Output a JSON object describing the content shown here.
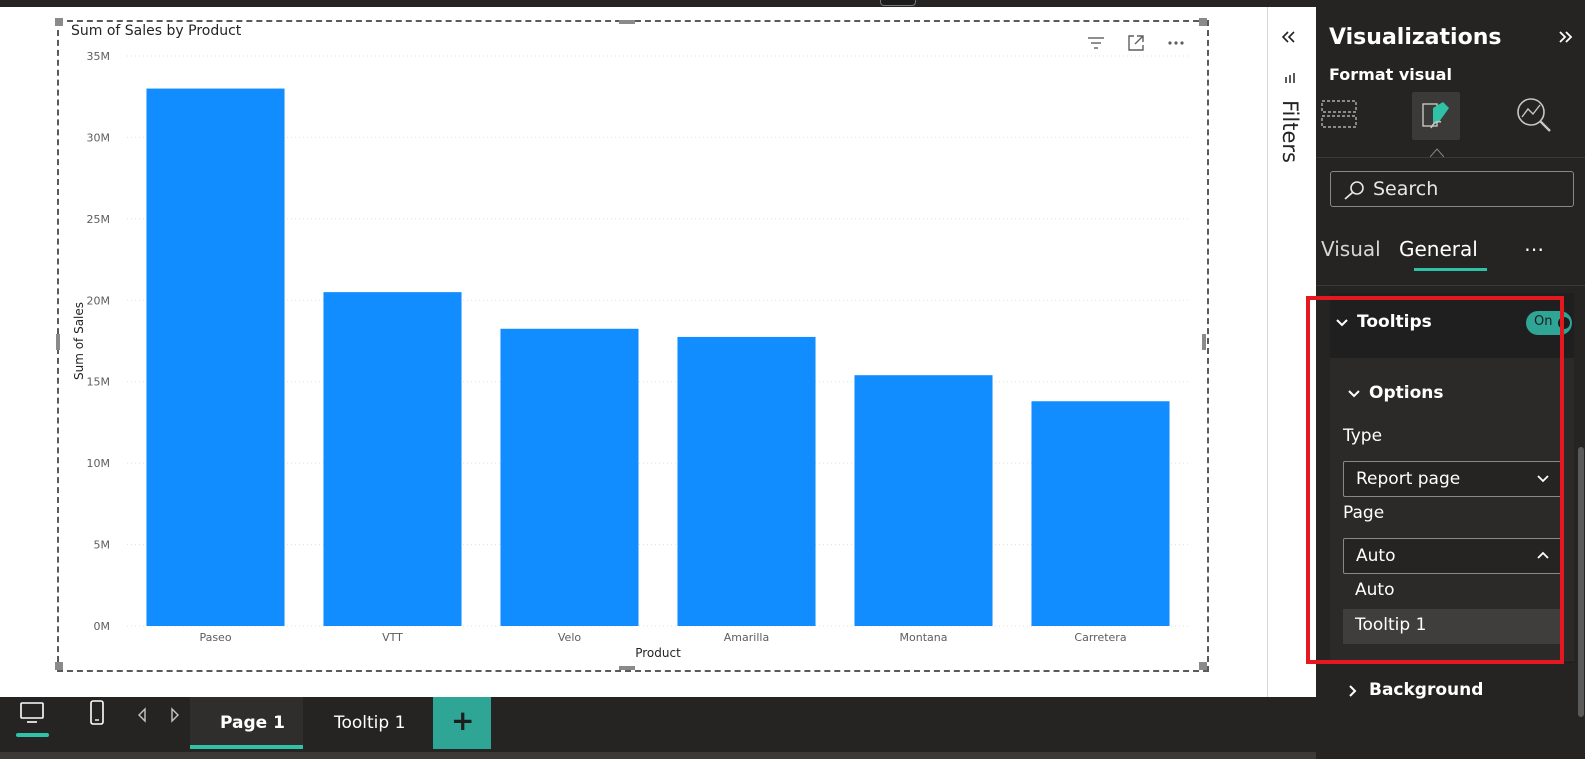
{
  "visual": {
    "title": "Sum of Sales by Product",
    "header_icons": [
      "filter-icon",
      "focus-mode-icon",
      "more-options-icon"
    ]
  },
  "chart_data": {
    "type": "bar",
    "title": "Sum of Sales by Product",
    "xlabel": "Product",
    "ylabel": "Sum of Sales",
    "categories": [
      "Paseo",
      "VTT",
      "Velo",
      "Amarilla",
      "Montana",
      "Carretera"
    ],
    "values": [
      33000000,
      20500000,
      18250000,
      17750000,
      15400000,
      13800000
    ],
    "ylim": [
      0,
      35000000
    ],
    "yticks": [
      "0M",
      "5M",
      "10M",
      "15M",
      "20M",
      "25M",
      "30M",
      "35M"
    ],
    "bar_color": "#118DFF",
    "grid": true,
    "legend": "none"
  },
  "filters_pane": {
    "label": "Filters",
    "collapse_icon": "double-chevron-left-icon",
    "filter_icon": "filter-bars-icon"
  },
  "viz_pane": {
    "title": "Visualizations",
    "expand_icon": "double-chevron-right-icon",
    "format_label": "Format visual",
    "icons": [
      "build-visual-icon",
      "format-visual-icon",
      "analytics-icon"
    ],
    "search_placeholder": "Search",
    "tabs": [
      "Visual",
      "General"
    ],
    "active_tab": "General",
    "more_label": "⋯",
    "tooltips": {
      "label": "Tooltips",
      "toggle_label": "On",
      "toggle_on": true
    },
    "options": {
      "label": "Options",
      "type_label": "Type",
      "type_value": "Report page",
      "page_label": "Page",
      "page_value": "Auto",
      "page_options": [
        "Auto",
        "Tooltip 1"
      ],
      "hovered_option": "Tooltip 1"
    },
    "background_label": "Background",
    "accent_color": "#2FC2A6",
    "highlight_color": "#E3191F"
  },
  "bottom_bar": {
    "view_icons": [
      "desktop-view-icon",
      "mobile-view-icon",
      "prev-page-icon",
      "next-page-icon"
    ],
    "pages": [
      "Page 1",
      "Tooltip 1"
    ],
    "active_page": "Page 1",
    "add_label": "+"
  }
}
